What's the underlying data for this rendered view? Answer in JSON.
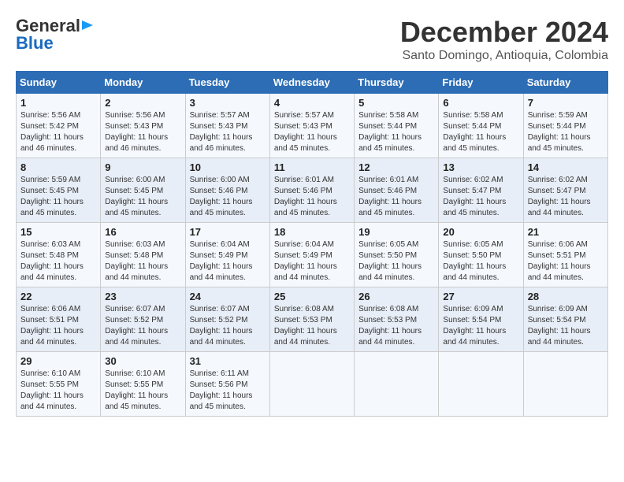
{
  "logo": {
    "line1": "General",
    "line2": "Blue"
  },
  "title": "December 2024",
  "subtitle": "Santo Domingo, Antioquia, Colombia",
  "headers": [
    "Sunday",
    "Monday",
    "Tuesday",
    "Wednesday",
    "Thursday",
    "Friday",
    "Saturday"
  ],
  "weeks": [
    [
      {
        "day": "1",
        "info": "Sunrise: 5:56 AM\nSunset: 5:42 PM\nDaylight: 11 hours\nand 46 minutes."
      },
      {
        "day": "2",
        "info": "Sunrise: 5:56 AM\nSunset: 5:43 PM\nDaylight: 11 hours\nand 46 minutes."
      },
      {
        "day": "3",
        "info": "Sunrise: 5:57 AM\nSunset: 5:43 PM\nDaylight: 11 hours\nand 46 minutes."
      },
      {
        "day": "4",
        "info": "Sunrise: 5:57 AM\nSunset: 5:43 PM\nDaylight: 11 hours\nand 45 minutes."
      },
      {
        "day": "5",
        "info": "Sunrise: 5:58 AM\nSunset: 5:44 PM\nDaylight: 11 hours\nand 45 minutes."
      },
      {
        "day": "6",
        "info": "Sunrise: 5:58 AM\nSunset: 5:44 PM\nDaylight: 11 hours\nand 45 minutes."
      },
      {
        "day": "7",
        "info": "Sunrise: 5:59 AM\nSunset: 5:44 PM\nDaylight: 11 hours\nand 45 minutes."
      }
    ],
    [
      {
        "day": "8",
        "info": "Sunrise: 5:59 AM\nSunset: 5:45 PM\nDaylight: 11 hours\nand 45 minutes."
      },
      {
        "day": "9",
        "info": "Sunrise: 6:00 AM\nSunset: 5:45 PM\nDaylight: 11 hours\nand 45 minutes."
      },
      {
        "day": "10",
        "info": "Sunrise: 6:00 AM\nSunset: 5:46 PM\nDaylight: 11 hours\nand 45 minutes."
      },
      {
        "day": "11",
        "info": "Sunrise: 6:01 AM\nSunset: 5:46 PM\nDaylight: 11 hours\nand 45 minutes."
      },
      {
        "day": "12",
        "info": "Sunrise: 6:01 AM\nSunset: 5:46 PM\nDaylight: 11 hours\nand 45 minutes."
      },
      {
        "day": "13",
        "info": "Sunrise: 6:02 AM\nSunset: 5:47 PM\nDaylight: 11 hours\nand 45 minutes."
      },
      {
        "day": "14",
        "info": "Sunrise: 6:02 AM\nSunset: 5:47 PM\nDaylight: 11 hours\nand 44 minutes."
      }
    ],
    [
      {
        "day": "15",
        "info": "Sunrise: 6:03 AM\nSunset: 5:48 PM\nDaylight: 11 hours\nand 44 minutes."
      },
      {
        "day": "16",
        "info": "Sunrise: 6:03 AM\nSunset: 5:48 PM\nDaylight: 11 hours\nand 44 minutes."
      },
      {
        "day": "17",
        "info": "Sunrise: 6:04 AM\nSunset: 5:49 PM\nDaylight: 11 hours\nand 44 minutes."
      },
      {
        "day": "18",
        "info": "Sunrise: 6:04 AM\nSunset: 5:49 PM\nDaylight: 11 hours\nand 44 minutes."
      },
      {
        "day": "19",
        "info": "Sunrise: 6:05 AM\nSunset: 5:50 PM\nDaylight: 11 hours\nand 44 minutes."
      },
      {
        "day": "20",
        "info": "Sunrise: 6:05 AM\nSunset: 5:50 PM\nDaylight: 11 hours\nand 44 minutes."
      },
      {
        "day": "21",
        "info": "Sunrise: 6:06 AM\nSunset: 5:51 PM\nDaylight: 11 hours\nand 44 minutes."
      }
    ],
    [
      {
        "day": "22",
        "info": "Sunrise: 6:06 AM\nSunset: 5:51 PM\nDaylight: 11 hours\nand 44 minutes."
      },
      {
        "day": "23",
        "info": "Sunrise: 6:07 AM\nSunset: 5:52 PM\nDaylight: 11 hours\nand 44 minutes."
      },
      {
        "day": "24",
        "info": "Sunrise: 6:07 AM\nSunset: 5:52 PM\nDaylight: 11 hours\nand 44 minutes."
      },
      {
        "day": "25",
        "info": "Sunrise: 6:08 AM\nSunset: 5:53 PM\nDaylight: 11 hours\nand 44 minutes."
      },
      {
        "day": "26",
        "info": "Sunrise: 6:08 AM\nSunset: 5:53 PM\nDaylight: 11 hours\nand 44 minutes."
      },
      {
        "day": "27",
        "info": "Sunrise: 6:09 AM\nSunset: 5:54 PM\nDaylight: 11 hours\nand 44 minutes."
      },
      {
        "day": "28",
        "info": "Sunrise: 6:09 AM\nSunset: 5:54 PM\nDaylight: 11 hours\nand 44 minutes."
      }
    ],
    [
      {
        "day": "29",
        "info": "Sunrise: 6:10 AM\nSunset: 5:55 PM\nDaylight: 11 hours\nand 44 minutes."
      },
      {
        "day": "30",
        "info": "Sunrise: 6:10 AM\nSunset: 5:55 PM\nDaylight: 11 hours\nand 45 minutes."
      },
      {
        "day": "31",
        "info": "Sunrise: 6:11 AM\nSunset: 5:56 PM\nDaylight: 11 hours\nand 45 minutes."
      },
      null,
      null,
      null,
      null
    ]
  ]
}
